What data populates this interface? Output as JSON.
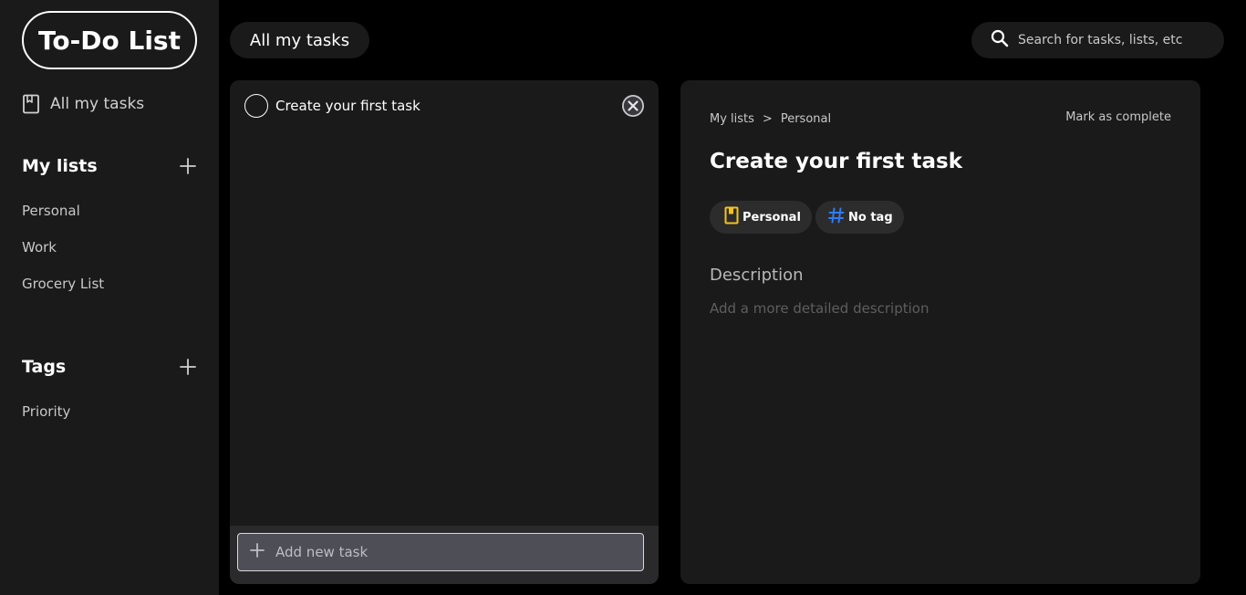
{
  "sidebar": {
    "logo": "To-Do List",
    "all_tasks": "All my tasks",
    "lists_title": "My lists",
    "lists": [
      {
        "label": "Personal"
      },
      {
        "label": "Work"
      },
      {
        "label": "Grocery List"
      }
    ],
    "tags_title": "Tags",
    "tags": [
      {
        "label": "Priority"
      }
    ]
  },
  "header": {
    "view_title": "All my tasks",
    "search_placeholder": "Search for tasks, lists, etc"
  },
  "tasks": {
    "items": [
      {
        "title": "Create your first task",
        "completed": false
      }
    ],
    "add_placeholder": "Add new task"
  },
  "detail": {
    "breadcrumb": [
      "My lists",
      ">",
      "Personal"
    ],
    "mark_complete": "Mark as complete",
    "title": "Create your first task",
    "list_chip": "Personal",
    "tag_chip": "No tag",
    "description_label": "Description",
    "description_placeholder": "Add a more detailed description"
  },
  "colors": {
    "accent_list": "#f5c21b",
    "accent_tag": "#2f7cf6",
    "background": "#000000",
    "panel": "#1a1a1a"
  },
  "icons": {
    "nav": "notebook-icon",
    "add": "plus-icon",
    "search": "search-icon",
    "close": "close-circle-icon",
    "list_chip": "notebook-icon",
    "tag_chip": "hashtag-icon"
  }
}
